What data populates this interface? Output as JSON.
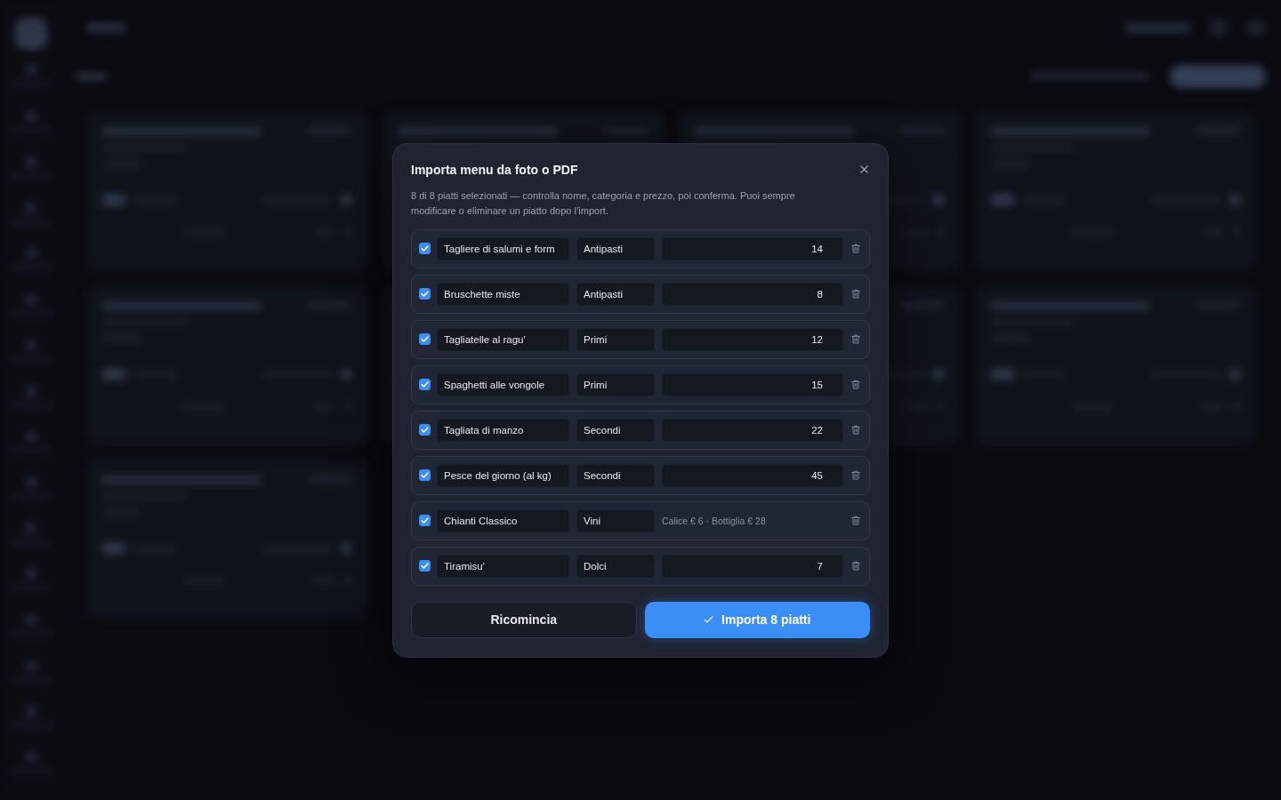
{
  "dialog": {
    "title": "Importa menu da foto o PDF",
    "description": "8 di 8 piatti selezionati — controlla nome, categoria e prezzo, poi conferma. Puoi sempre modificare o eliminare un piatto dopo l’import.",
    "items": [
      {
        "checked": true,
        "name": "Tagliere di salumi e form",
        "category": "Antipasti",
        "price": {
          "kind": "input",
          "value": "14"
        }
      },
      {
        "checked": true,
        "name": "Bruschette miste",
        "category": "Antipasti",
        "price": {
          "kind": "input",
          "value": "8"
        }
      },
      {
        "checked": true,
        "name": "Tagliatelle al ragu'",
        "category": "Primi",
        "price": {
          "kind": "input",
          "value": "12"
        }
      },
      {
        "checked": true,
        "name": "Spaghetti alle vongole",
        "category": "Primi",
        "price": {
          "kind": "input",
          "value": "15"
        }
      },
      {
        "checked": true,
        "name": "Tagliata di manzo",
        "category": "Secondi",
        "price": {
          "kind": "input",
          "value": "22"
        }
      },
      {
        "checked": true,
        "name": "Pesce del giorno (al kg)",
        "category": "Secondi",
        "price": {
          "kind": "input",
          "value": "45"
        }
      },
      {
        "checked": true,
        "name": "Chianti Classico",
        "category": "Vini",
        "price": {
          "kind": "text",
          "value": "Calice € 6 · Bottiglia € 28"
        }
      },
      {
        "checked": true,
        "name": "Tiramisu'",
        "category": "Dolci",
        "price": {
          "kind": "input",
          "value": "7"
        }
      }
    ],
    "buttons": [
      {
        "kind": "secondary",
        "label": "Ricomincia"
      },
      {
        "kind": "primary",
        "label": "Importa 8 piatti"
      }
    ]
  }
}
